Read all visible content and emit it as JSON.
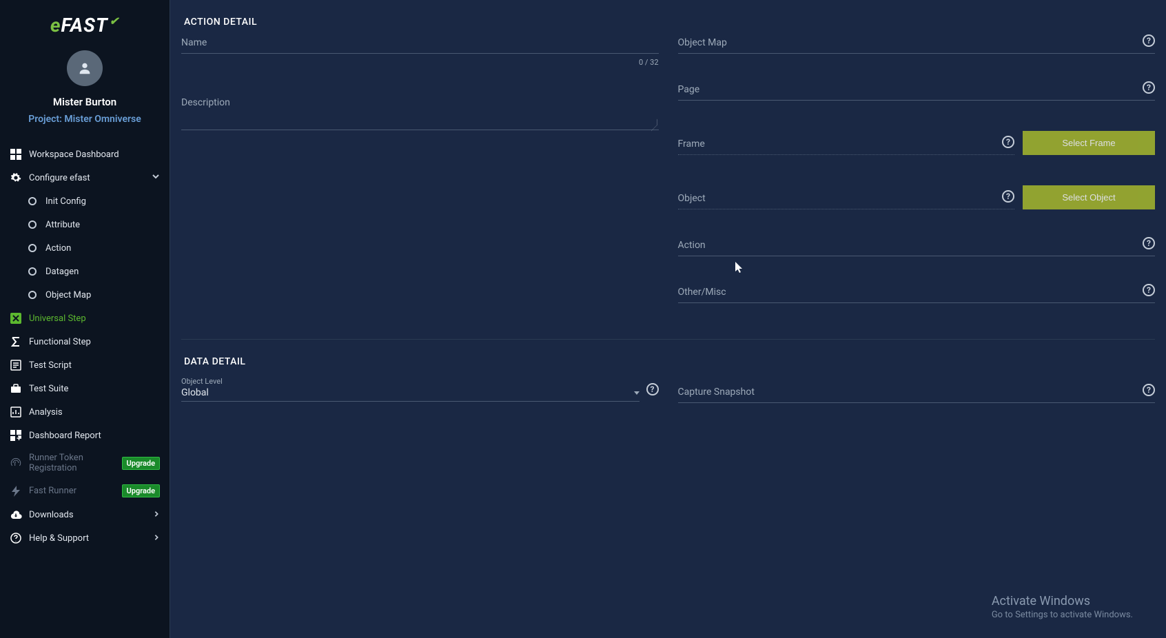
{
  "brand": {
    "prefix": "e",
    "name": "FAST"
  },
  "user": {
    "name": "Mister Burton",
    "project_label": "Project: Mister Omniverse"
  },
  "sidebar": {
    "items": [
      {
        "label": "Workspace Dashboard"
      },
      {
        "label": "Configure efast"
      },
      {
        "label": "Init Config"
      },
      {
        "label": "Attribute"
      },
      {
        "label": "Action"
      },
      {
        "label": "Datagen"
      },
      {
        "label": "Object Map"
      },
      {
        "label": "Universal Step"
      },
      {
        "label": "Functional Step"
      },
      {
        "label": "Test Script"
      },
      {
        "label": "Test Suite"
      },
      {
        "label": "Analysis"
      },
      {
        "label": "Dashboard Report"
      },
      {
        "label": "Runner Token Registration"
      },
      {
        "label": "Fast Runner"
      },
      {
        "label": "Downloads"
      },
      {
        "label": "Help & Support"
      }
    ],
    "upgrade_badge": "Upgrade"
  },
  "section_action": "ACTION DETAIL",
  "section_data": "DATA DETAIL",
  "fields": {
    "name": {
      "label": "Name",
      "counter": "0 / 32"
    },
    "description": {
      "label": "Description"
    },
    "object_map": {
      "label": "Object Map"
    },
    "page": {
      "label": "Page"
    },
    "frame": {
      "label": "Frame",
      "button": "Select Frame"
    },
    "object": {
      "label": "Object",
      "button": "Select Object"
    },
    "action": {
      "label": "Action"
    },
    "other": {
      "label": "Other/Misc"
    },
    "object_level": {
      "label": "Object Level",
      "value": "Global"
    },
    "capture_snapshot": {
      "label": "Capture Snapshot"
    }
  },
  "watermark": {
    "title": "Activate Windows",
    "subtitle": "Go to Settings to activate Windows."
  }
}
